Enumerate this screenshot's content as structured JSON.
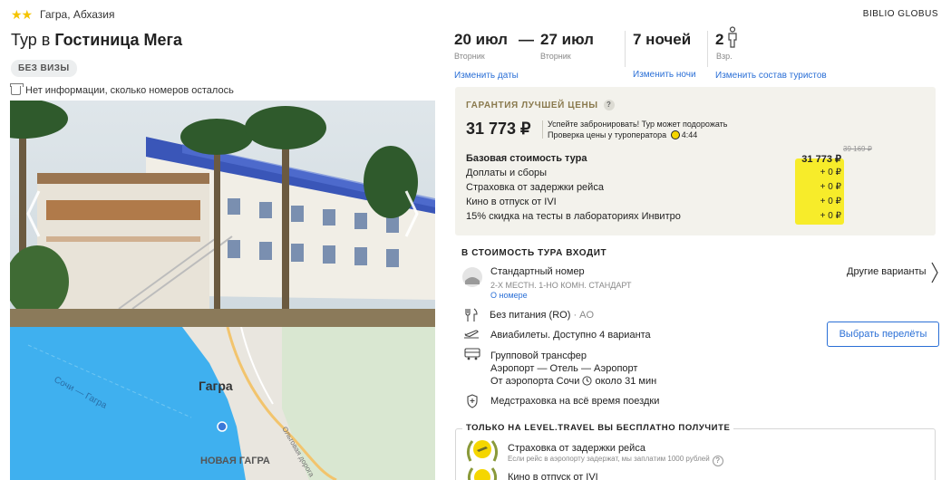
{
  "hotel": {
    "stars": "★★",
    "location": "Гагра, Абхазия",
    "title_prefix": "Тур в ",
    "title_name": "Гостиница Мега",
    "visa_badge": "БЕЗ ВИЗЫ",
    "rooms_info": "Нет информации, сколько номеров осталось"
  },
  "map": {
    "city_label": "Гагра",
    "district_label": "НОВАЯ ГАГРА",
    "ferry_label": "Сочи — Гагра",
    "road_label": "Ольговая дорога"
  },
  "brand": "BIBLIO GLOBUS",
  "trip": {
    "date_from": "20 июл",
    "dash": "—",
    "date_to": "27 июл",
    "day_from": "Вторник",
    "day_to": "Вторник",
    "change_dates": "Изменить даты",
    "nights": "7 ночей",
    "change_nights": "Изменить ночи",
    "tourists_count": "2",
    "tourists_sub": "Взр.",
    "change_tourists": "Изменить состав туристов"
  },
  "guarantee": {
    "title": "ГАРАНТИЯ ЛУЧШЕЙ ЦЕНЫ",
    "help": "?",
    "price": "31 773 ₽",
    "note_line1": "Успейте забронировать! Тур может подорожать",
    "note_line2": "Проверка цены у туроператора",
    "timer": "4:44",
    "old_price": "39 169 ₽",
    "lines": [
      {
        "label": "Базовая стоимость тура",
        "value": "31 773 ₽"
      },
      {
        "label": "Доплаты и сборы",
        "value": "+ 0 ₽"
      },
      {
        "label": "Страховка от задержки рейса",
        "value": "+ 0 ₽"
      },
      {
        "label": "Кино в отпуск от IVI",
        "value": "+ 0 ₽"
      },
      {
        "label": "15% скидка на тесты в лабораториях Инвитро",
        "value": "+ 0 ₽"
      }
    ]
  },
  "included": {
    "heading": "В СТОИМОСТЬ ТУРА ВХОДИТ",
    "room_name": "Стандартный номер",
    "room_desc": "2-Х МЕСТН. 1-НО КОМН. СТАНДАРТ",
    "room_link": "О номере",
    "other_options": "Другие варианты",
    "meal": "Без питания (RO)",
    "meal_code": "· AO",
    "flights": "Авиабилеты. Доступно 4 варианта",
    "flights_button": "Выбрать перелёты",
    "transfer_title": "Групповой трансфер",
    "transfer_route": "Аэропорт — Отель — Аэропорт",
    "transfer_from": "От аэропорта Сочи",
    "transfer_time": "около 31 мин",
    "insurance": "Медстраховка на всё время поездки"
  },
  "bonus": {
    "heading": "ТОЛЬКО НА LEVEL.TRAVEL ВЫ БЕСПЛАТНО ПОЛУЧИТЕ",
    "item1_title": "Страховка от задержки рейса",
    "item1_sub": "Если рейс в аэропорту задержат, мы заплатим 1000 рублей",
    "item2_title": "Кино в отпуск от IVI"
  },
  "colors": {
    "link": "#2a6fd6",
    "guarantee_bg": "#f3f2ec",
    "highlight": "#f7ec2a",
    "star": "#f5c400"
  }
}
